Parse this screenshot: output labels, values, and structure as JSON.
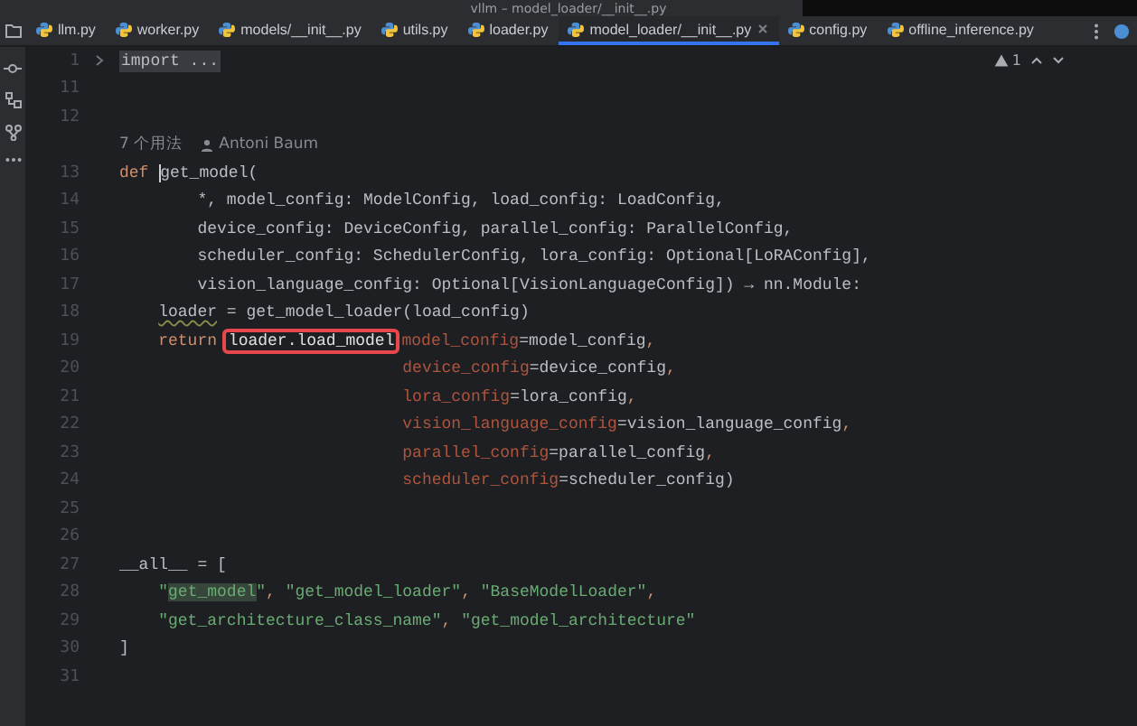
{
  "window": {
    "title": "vllm – model_loader/__init__.py"
  },
  "tabs": [
    {
      "label": "llm.py",
      "selected": false
    },
    {
      "label": "worker.py",
      "selected": false
    },
    {
      "label": "models/__init__.py",
      "selected": false
    },
    {
      "label": "utils.py",
      "selected": false
    },
    {
      "label": "loader.py",
      "selected": false
    },
    {
      "label": "model_loader/__init__.py",
      "selected": true
    },
    {
      "label": "config.py",
      "selected": false
    },
    {
      "label": "offline_inference.py",
      "selected": false
    }
  ],
  "inspection": {
    "warnings": "1"
  },
  "inlay_hint": {
    "usages": "7 个用法",
    "author": "Antoni Baum"
  },
  "lines": [
    {
      "number": "1",
      "tokens": [
        {
          "text": "import ...",
          "kind": "fold"
        }
      ]
    },
    {
      "number": "11"
    },
    {
      "number": "12"
    },
    {
      "kind": "hint"
    },
    {
      "number": "13",
      "tokens": [
        {
          "text": "def ",
          "kind": "kw"
        },
        {
          "text": "get_model",
          "kind": "cursor"
        },
        {
          "text": "(",
          "kind": "plain"
        }
      ]
    },
    {
      "number": "14",
      "tokens": [
        {
          "text": "        *, model_config: ModelConfig, load_config: LoadConfig,",
          "kind": "plain"
        }
      ]
    },
    {
      "number": "15",
      "tokens": [
        {
          "text": "        device_config: DeviceConfig, parallel_config: ParallelConfig,",
          "kind": "plain"
        }
      ]
    },
    {
      "number": "16",
      "tokens": [
        {
          "text": "        scheduler_config: SchedulerConfig, lora_config: Optional[LoRAConfig],",
          "kind": "plain"
        }
      ]
    },
    {
      "number": "17",
      "tokens": [
        {
          "text": "        vision_language_config: Optional[VisionLanguageConfig]) → nn.Module:",
          "kind": "plain"
        }
      ]
    },
    {
      "number": "18",
      "tokens": [
        {
          "text": "    loader",
          "kind": "squiggle"
        },
        {
          "text": " = get_model_loader(load_config)",
          "kind": "plain"
        }
      ]
    },
    {
      "number": "19",
      "tokens": [
        {
          "text": "    return ",
          "kind": "kw"
        },
        {
          "text": "loader.load_model",
          "kind": "boxed"
        },
        {
          "text": "model_config",
          "kind": "arg"
        },
        {
          "text": "=model_config",
          "kind": "plain"
        },
        {
          "text": ",",
          "kind": "punct"
        }
      ]
    },
    {
      "number": "20",
      "tokens": [
        {
          "text": "                             device_config",
          "kind": "arg"
        },
        {
          "text": "=device_config",
          "kind": "plain"
        },
        {
          "text": ",",
          "kind": "punct"
        }
      ]
    },
    {
      "number": "21",
      "tokens": [
        {
          "text": "                             lora_config",
          "kind": "arg"
        },
        {
          "text": "=lora_config",
          "kind": "plain"
        },
        {
          "text": ",",
          "kind": "punct"
        }
      ]
    },
    {
      "number": "22",
      "tokens": [
        {
          "text": "                             vision_language_config",
          "kind": "arg"
        },
        {
          "text": "=vision_language_config",
          "kind": "plain"
        },
        {
          "text": ",",
          "kind": "punct"
        }
      ]
    },
    {
      "number": "23",
      "tokens": [
        {
          "text": "                             parallel_config",
          "kind": "arg"
        },
        {
          "text": "=parallel_config",
          "kind": "plain"
        },
        {
          "text": ",",
          "kind": "punct"
        }
      ]
    },
    {
      "number": "24",
      "tokens": [
        {
          "text": "                             scheduler_config",
          "kind": "arg"
        },
        {
          "text": "=scheduler_config)",
          "kind": "plain"
        }
      ]
    },
    {
      "number": "25"
    },
    {
      "number": "26"
    },
    {
      "number": "27",
      "tokens": [
        {
          "text": "__all__ = [",
          "kind": "plain"
        }
      ]
    },
    {
      "number": "28",
      "tokens": [
        {
          "text": "    \"",
          "kind": "str"
        },
        {
          "text": "get_model",
          "kind": "match"
        },
        {
          "text": "\"",
          "kind": "str"
        },
        {
          "text": ", ",
          "kind": "punct"
        },
        {
          "text": "\"get_model_loader\"",
          "kind": "str"
        },
        {
          "text": ", ",
          "kind": "punct"
        },
        {
          "text": "\"BaseModelLoader\"",
          "kind": "str"
        },
        {
          "text": ",",
          "kind": "punct"
        }
      ]
    },
    {
      "number": "29",
      "tokens": [
        {
          "text": "    \"get_architecture_class_name\"",
          "kind": "str"
        },
        {
          "text": ", ",
          "kind": "punct"
        },
        {
          "text": "\"get_model_architecture\"",
          "kind": "str"
        }
      ]
    },
    {
      "number": "30",
      "tokens": [
        {
          "text": "]",
          "kind": "plain"
        }
      ]
    },
    {
      "number": "31"
    }
  ]
}
